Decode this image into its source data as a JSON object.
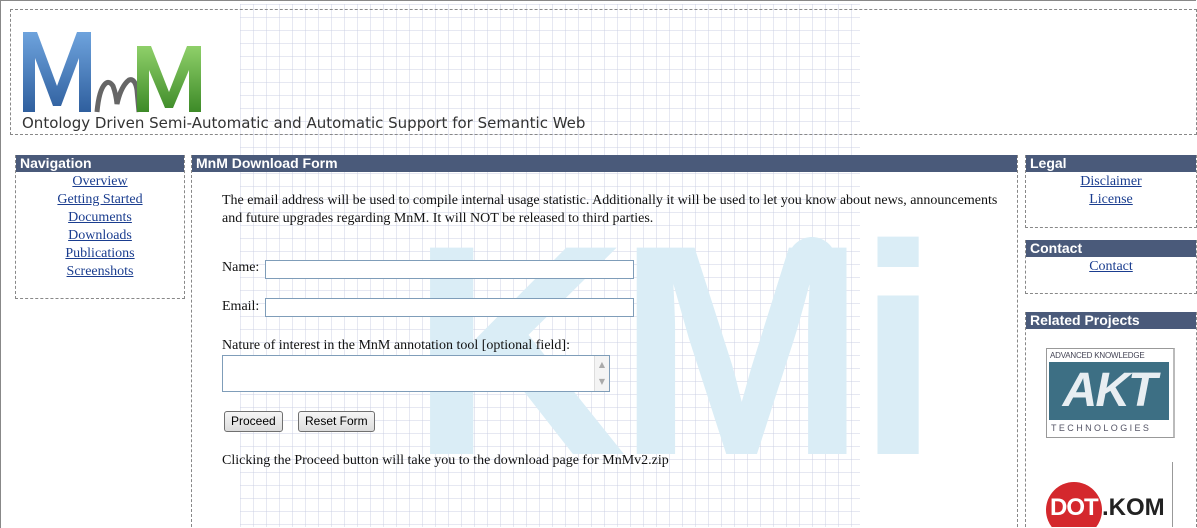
{
  "header": {
    "logo_text": "MnM",
    "tagline": "Ontology Driven Semi-Automatic and Automatic Support for Semantic Web"
  },
  "background_watermark": "KMi",
  "navigation": {
    "title": "Navigation",
    "items": [
      {
        "label": "Overview"
      },
      {
        "label": "Getting Started"
      },
      {
        "label": "Documents"
      },
      {
        "label": "Downloads"
      },
      {
        "label": "Publications"
      },
      {
        "label": "Screenshots"
      }
    ]
  },
  "form": {
    "title": "MnM Download Form",
    "intro": "The email address will be used to compile internal usage statistic. Additionally it will be used to let you know about news, announcements and future upgrades regarding MnM. It will NOT be released to third parties.",
    "name_label": "Name:",
    "name_value": "",
    "email_label": "Email:",
    "email_value": "",
    "interest_label": "Nature of interest in the MnM annotation tool [optional field]:",
    "interest_value": "",
    "proceed_label": "Proceed",
    "reset_label": "Reset Form",
    "footnote": "Clicking the Proceed button will take you to the download page for MnMv2.zip"
  },
  "legal": {
    "title": "Legal",
    "items": [
      {
        "label": "Disclaimer"
      },
      {
        "label": "License"
      }
    ]
  },
  "contact": {
    "title": "Contact",
    "items": [
      {
        "label": "Contact"
      }
    ]
  },
  "related": {
    "title": "Related Projects",
    "akt": {
      "top_text": "ADVANCED KNOWLEDGE",
      "logo_text": "AKT",
      "bottom_text": "TECHNOLOGIES"
    },
    "dotkom": {
      "dot_text": "DOT",
      "kom_text": ".KOM"
    }
  },
  "colors": {
    "panel_header": "#4a5a7a",
    "link": "#1a3d8f",
    "logo_blue": "#3a6fb0",
    "logo_green": "#5aa63a",
    "watermark": "#daedf6"
  }
}
